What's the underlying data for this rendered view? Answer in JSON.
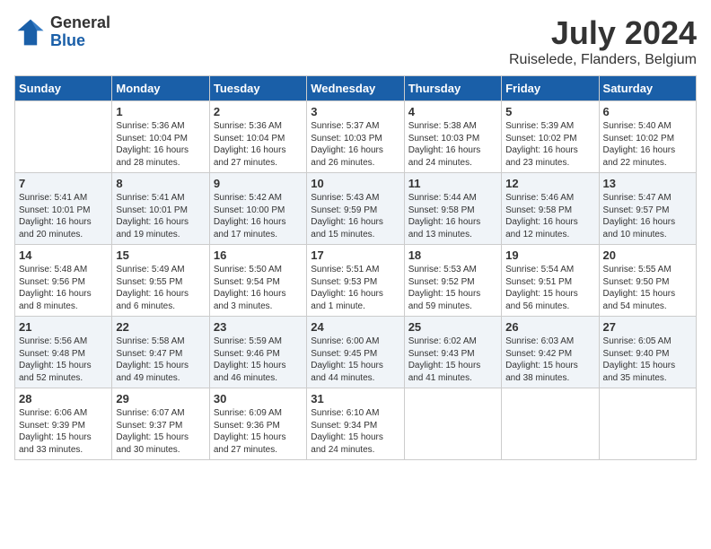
{
  "header": {
    "logo_general": "General",
    "logo_blue": "Blue",
    "month_title": "July 2024",
    "location": "Ruiselede, Flanders, Belgium"
  },
  "weekdays": [
    "Sunday",
    "Monday",
    "Tuesday",
    "Wednesday",
    "Thursday",
    "Friday",
    "Saturday"
  ],
  "weeks": [
    [
      {
        "day": "",
        "info": ""
      },
      {
        "day": "1",
        "info": "Sunrise: 5:36 AM\nSunset: 10:04 PM\nDaylight: 16 hours\nand 28 minutes."
      },
      {
        "day": "2",
        "info": "Sunrise: 5:36 AM\nSunset: 10:04 PM\nDaylight: 16 hours\nand 27 minutes."
      },
      {
        "day": "3",
        "info": "Sunrise: 5:37 AM\nSunset: 10:03 PM\nDaylight: 16 hours\nand 26 minutes."
      },
      {
        "day": "4",
        "info": "Sunrise: 5:38 AM\nSunset: 10:03 PM\nDaylight: 16 hours\nand 24 minutes."
      },
      {
        "day": "5",
        "info": "Sunrise: 5:39 AM\nSunset: 10:02 PM\nDaylight: 16 hours\nand 23 minutes."
      },
      {
        "day": "6",
        "info": "Sunrise: 5:40 AM\nSunset: 10:02 PM\nDaylight: 16 hours\nand 22 minutes."
      }
    ],
    [
      {
        "day": "7",
        "info": "Sunrise: 5:41 AM\nSunset: 10:01 PM\nDaylight: 16 hours\nand 20 minutes."
      },
      {
        "day": "8",
        "info": "Sunrise: 5:41 AM\nSunset: 10:01 PM\nDaylight: 16 hours\nand 19 minutes."
      },
      {
        "day": "9",
        "info": "Sunrise: 5:42 AM\nSunset: 10:00 PM\nDaylight: 16 hours\nand 17 minutes."
      },
      {
        "day": "10",
        "info": "Sunrise: 5:43 AM\nSunset: 9:59 PM\nDaylight: 16 hours\nand 15 minutes."
      },
      {
        "day": "11",
        "info": "Sunrise: 5:44 AM\nSunset: 9:58 PM\nDaylight: 16 hours\nand 13 minutes."
      },
      {
        "day": "12",
        "info": "Sunrise: 5:46 AM\nSunset: 9:58 PM\nDaylight: 16 hours\nand 12 minutes."
      },
      {
        "day": "13",
        "info": "Sunrise: 5:47 AM\nSunset: 9:57 PM\nDaylight: 16 hours\nand 10 minutes."
      }
    ],
    [
      {
        "day": "14",
        "info": "Sunrise: 5:48 AM\nSunset: 9:56 PM\nDaylight: 16 hours\nand 8 minutes."
      },
      {
        "day": "15",
        "info": "Sunrise: 5:49 AM\nSunset: 9:55 PM\nDaylight: 16 hours\nand 6 minutes."
      },
      {
        "day": "16",
        "info": "Sunrise: 5:50 AM\nSunset: 9:54 PM\nDaylight: 16 hours\nand 3 minutes."
      },
      {
        "day": "17",
        "info": "Sunrise: 5:51 AM\nSunset: 9:53 PM\nDaylight: 16 hours\nand 1 minute."
      },
      {
        "day": "18",
        "info": "Sunrise: 5:53 AM\nSunset: 9:52 PM\nDaylight: 15 hours\nand 59 minutes."
      },
      {
        "day": "19",
        "info": "Sunrise: 5:54 AM\nSunset: 9:51 PM\nDaylight: 15 hours\nand 56 minutes."
      },
      {
        "day": "20",
        "info": "Sunrise: 5:55 AM\nSunset: 9:50 PM\nDaylight: 15 hours\nand 54 minutes."
      }
    ],
    [
      {
        "day": "21",
        "info": "Sunrise: 5:56 AM\nSunset: 9:48 PM\nDaylight: 15 hours\nand 52 minutes."
      },
      {
        "day": "22",
        "info": "Sunrise: 5:58 AM\nSunset: 9:47 PM\nDaylight: 15 hours\nand 49 minutes."
      },
      {
        "day": "23",
        "info": "Sunrise: 5:59 AM\nSunset: 9:46 PM\nDaylight: 15 hours\nand 46 minutes."
      },
      {
        "day": "24",
        "info": "Sunrise: 6:00 AM\nSunset: 9:45 PM\nDaylight: 15 hours\nand 44 minutes."
      },
      {
        "day": "25",
        "info": "Sunrise: 6:02 AM\nSunset: 9:43 PM\nDaylight: 15 hours\nand 41 minutes."
      },
      {
        "day": "26",
        "info": "Sunrise: 6:03 AM\nSunset: 9:42 PM\nDaylight: 15 hours\nand 38 minutes."
      },
      {
        "day": "27",
        "info": "Sunrise: 6:05 AM\nSunset: 9:40 PM\nDaylight: 15 hours\nand 35 minutes."
      }
    ],
    [
      {
        "day": "28",
        "info": "Sunrise: 6:06 AM\nSunset: 9:39 PM\nDaylight: 15 hours\nand 33 minutes."
      },
      {
        "day": "29",
        "info": "Sunrise: 6:07 AM\nSunset: 9:37 PM\nDaylight: 15 hours\nand 30 minutes."
      },
      {
        "day": "30",
        "info": "Sunrise: 6:09 AM\nSunset: 9:36 PM\nDaylight: 15 hours\nand 27 minutes."
      },
      {
        "day": "31",
        "info": "Sunrise: 6:10 AM\nSunset: 9:34 PM\nDaylight: 15 hours\nand 24 minutes."
      },
      {
        "day": "",
        "info": ""
      },
      {
        "day": "",
        "info": ""
      },
      {
        "day": "",
        "info": ""
      }
    ]
  ]
}
